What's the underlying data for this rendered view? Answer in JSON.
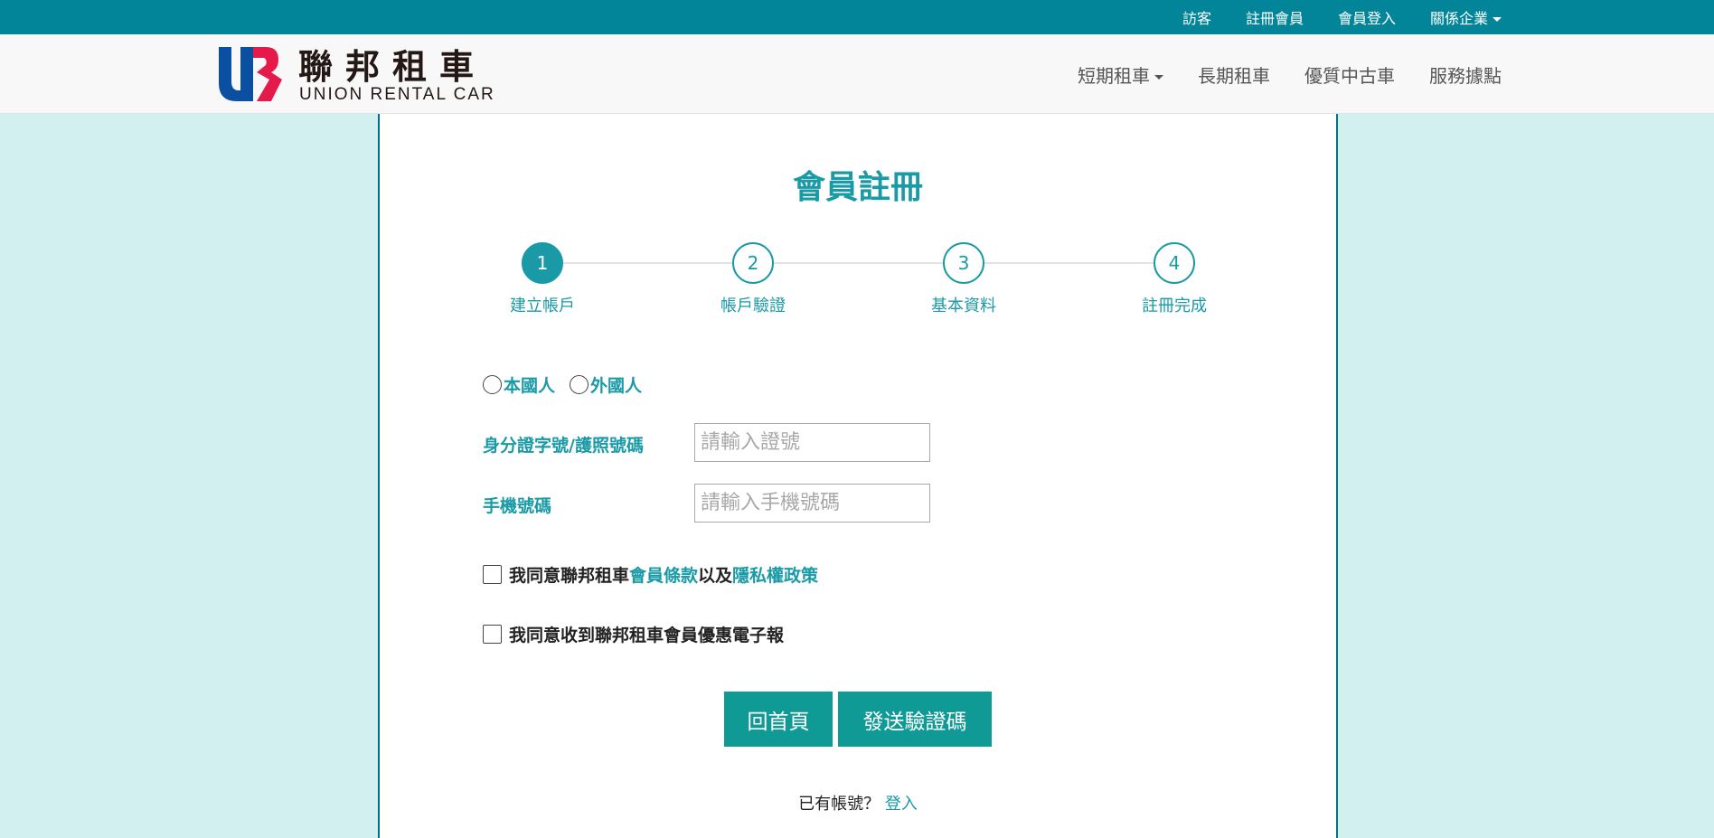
{
  "topbar": {
    "items": [
      {
        "label": "訪客"
      },
      {
        "label": "註冊會員"
      },
      {
        "label": "會員登入"
      },
      {
        "label": "關係企業"
      }
    ]
  },
  "brand": {
    "name_cn": "聯邦租車",
    "name_en": "UNION RENTAL CAR",
    "colors": {
      "blue": "#0a4fa0",
      "red": "#e6194b"
    }
  },
  "nav": {
    "items": [
      {
        "label": "短期租車"
      },
      {
        "label": "長期租車"
      },
      {
        "label": "優質中古車"
      },
      {
        "label": "服務據點"
      }
    ]
  },
  "page": {
    "title": "會員註冊"
  },
  "steps": [
    {
      "number": "1",
      "label": "建立帳戶",
      "active": true
    },
    {
      "number": "2",
      "label": "帳戶驗證",
      "active": false
    },
    {
      "number": "3",
      "label": "基本資料",
      "active": false
    },
    {
      "number": "4",
      "label": "註冊完成",
      "active": false
    }
  ],
  "form": {
    "nationality": [
      {
        "label": "本國人"
      },
      {
        "label": "外國人"
      }
    ],
    "id_field": {
      "label": "身分證字號/護照號碼",
      "placeholder": "請輸入證號",
      "value": ""
    },
    "phone_field": {
      "label": "手機號碼",
      "placeholder": "請輸入手機號碼",
      "value": ""
    },
    "agree_terms": {
      "prefix": "我同意聯邦租車",
      "terms_link": "會員條款",
      "middle": "以及",
      "privacy_link": "隱私權政策"
    },
    "agree_newsletter": {
      "label": "我同意收到聯邦租車會員優惠電子報"
    }
  },
  "buttons": {
    "home": "回首頁",
    "send": "發送驗證碼"
  },
  "login": {
    "prompt": "已有帳號？",
    "link": "登入"
  },
  "colors": {
    "topbar": "#028599",
    "accent": "#1a9aa6",
    "button": "#0f9a96",
    "page_bg": "#d3f0f0"
  }
}
